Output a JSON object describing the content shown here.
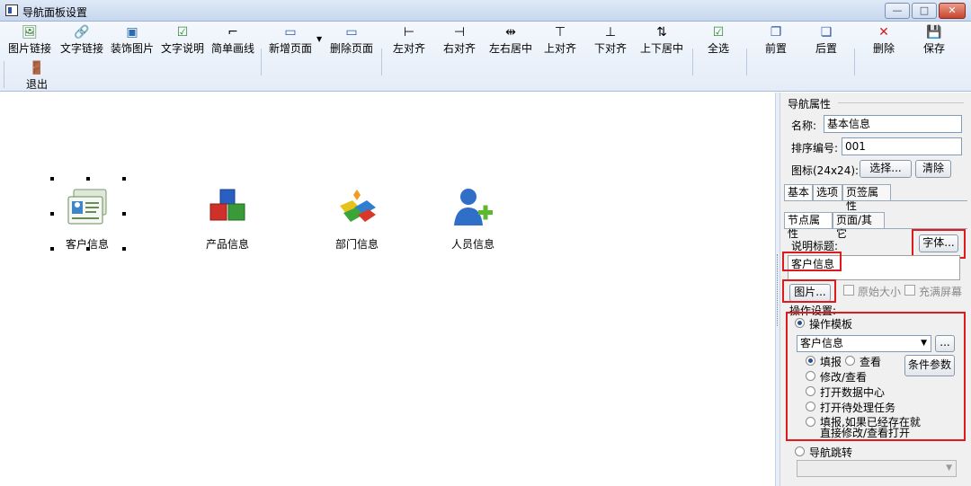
{
  "window": {
    "title": "导航面板设置",
    "min_label": "—",
    "max_label": "□",
    "close_label": "✕"
  },
  "toolbar": {
    "buttons": [
      {
        "label": "图片链接",
        "icon": "image-link-icon",
        "glyph": "🖼"
      },
      {
        "label": "文字链接",
        "icon": "text-link-icon",
        "glyph": "🔗"
      },
      {
        "label": "装饰图片",
        "icon": "decor-image-icon",
        "glyph": "▣"
      },
      {
        "label": "文字说明",
        "icon": "text-note-icon",
        "glyph": "☑"
      },
      {
        "label": "简单画线",
        "icon": "draw-line-icon",
        "glyph": "⌐"
      },
      {
        "label": "新增页面",
        "icon": "new-page-icon",
        "glyph": "▭"
      },
      {
        "label": "删除页面",
        "icon": "delete-page-icon",
        "glyph": "▭"
      },
      {
        "label": "左对齐",
        "icon": "align-left-icon",
        "glyph": "⊢"
      },
      {
        "label": "右对齐",
        "icon": "align-right-icon",
        "glyph": "⊣"
      },
      {
        "label": "左右居中",
        "icon": "align-hcenter-icon",
        "glyph": "⇹"
      },
      {
        "label": "上对齐",
        "icon": "align-top-icon",
        "glyph": "⊤"
      },
      {
        "label": "下对齐",
        "icon": "align-bottom-icon",
        "glyph": "⊥"
      },
      {
        "label": "上下居中",
        "icon": "align-vcenter-icon",
        "glyph": "⇅"
      },
      {
        "label": "全选",
        "icon": "select-all-icon",
        "glyph": "☑"
      },
      {
        "label": "前置",
        "icon": "bring-front-icon",
        "glyph": "❐"
      },
      {
        "label": "后置",
        "icon": "send-back-icon",
        "glyph": "❏"
      },
      {
        "label": "删除",
        "icon": "delete-icon",
        "glyph": "✕"
      },
      {
        "label": "保存",
        "icon": "save-icon",
        "glyph": "💾"
      }
    ],
    "exit": {
      "label": "退出",
      "icon": "exit-icon",
      "glyph": "🚪"
    }
  },
  "canvas": {
    "items": [
      {
        "caption": "客户信息",
        "icon": "customer-card-icon"
      },
      {
        "caption": "产品信息",
        "icon": "product-cubes-icon"
      },
      {
        "caption": "部门信息",
        "icon": "department-puzzle-icon"
      },
      {
        "caption": "人员信息",
        "icon": "add-person-icon"
      }
    ]
  },
  "panel": {
    "nav_props_title": "导航属性",
    "name_label": "名称:",
    "name_value": "基本信息",
    "order_label": "排序编号:",
    "order_value": "001",
    "icon_label": "图标(24x24):",
    "select_btn": "选择...",
    "clear_btn": "清除",
    "tabs": [
      "基本",
      "选项",
      "页签属性"
    ],
    "subtabs": [
      "节点属性",
      "页面/其它"
    ],
    "caption_label": "说明标题:",
    "font_btn": "字体...",
    "caption_value": "客户信息",
    "picture_btn": "图片...",
    "orig_size_label": "原始大小",
    "fill_screen_label": "充满屏幕",
    "operation_label": "操作设置:",
    "template_label": "操作模板",
    "template_value": "客户信息",
    "template_more": "...",
    "cond_param_btn": "条件参数",
    "options": [
      "填报",
      "查看",
      "修改/查看",
      "打开数据中心",
      "打开待处理任务",
      "填报,如果已经存在就",
      "直接修改/查看打开"
    ],
    "nav_jump_label": "导航跳转"
  },
  "colors": {
    "highlight": "#e0191d",
    "accent": "#2b56a8"
  }
}
